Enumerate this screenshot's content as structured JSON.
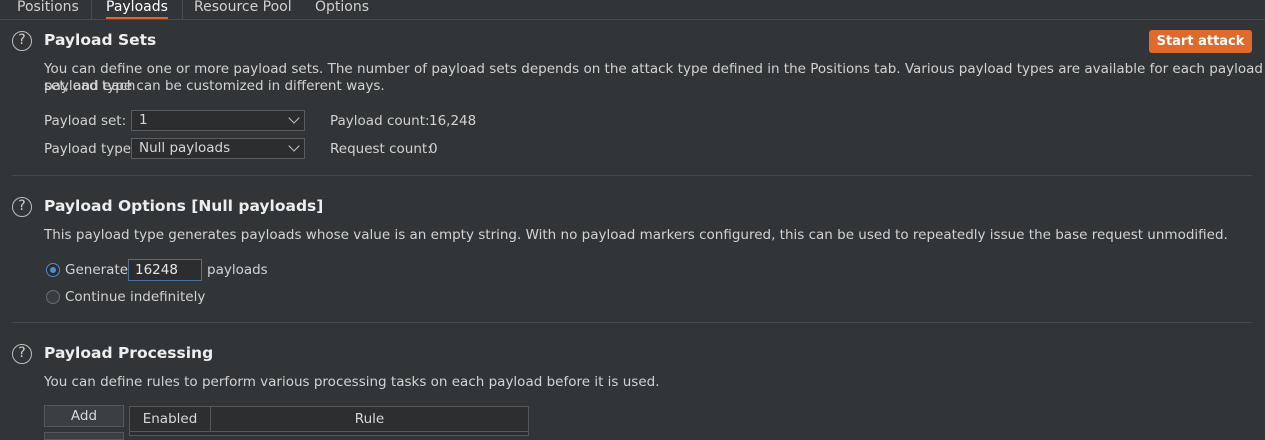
{
  "tabs": [
    "Positions",
    "Payloads",
    "Resource Pool",
    "Options"
  ],
  "start_attack_label": "Start attack",
  "payload_sets": {
    "title": "Payload Sets",
    "description_line1": "You can define one or more payload sets. The number of payload sets depends on the attack type defined in the Positions tab. Various payload types are available for each payload set, and each",
    "description_line2": "payload type can be customized in different ways.",
    "set_label": "Payload set:",
    "set_value": "1",
    "type_label": "Payload type:",
    "type_value": "Null payloads",
    "payload_count_label": "Payload count:",
    "payload_count_value": "16,248",
    "request_count_label": "Request count:",
    "request_count_value": "0"
  },
  "payload_options": {
    "title": "Payload Options [Null payloads]",
    "description": "This payload type generates payloads whose value is an empty string. With no payload markers configured, this can be used to repeatedly issue the base request unmodified.",
    "generate_label": "Generate",
    "generate_value": "16248",
    "payloads_suffix": "payloads",
    "continue_label": "Continue indefinitely"
  },
  "payload_processing": {
    "title": "Payload Processing",
    "description": "You can define rules to perform various processing tasks on each payload before it is used.",
    "add_label": "Add",
    "col_enabled": "Enabled",
    "col_rule": "Rule"
  },
  "help_glyph": "?",
  "colors": {
    "accent": "#e06a2b",
    "background": "#323537",
    "focus": "#4a8fd6"
  }
}
